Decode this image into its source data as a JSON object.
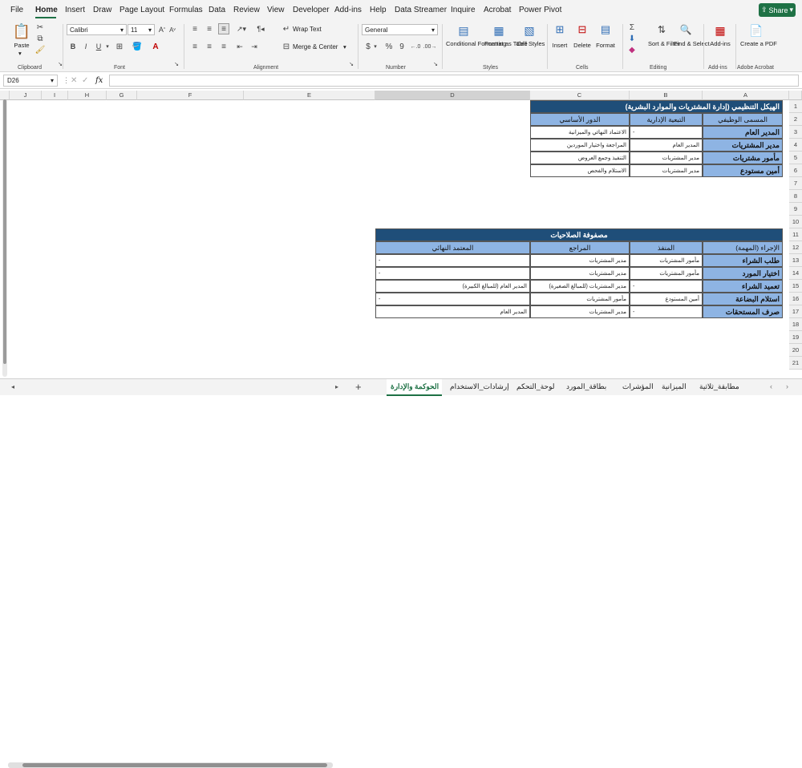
{
  "menu": {
    "tabs": [
      "File",
      "Home",
      "Insert",
      "Draw",
      "Page Layout",
      "Formulas",
      "Data",
      "Review",
      "View",
      "Developer",
      "Add-ins",
      "Help",
      "Data Streamer",
      "Inquire",
      "Acrobat",
      "Power Pivot"
    ],
    "share": "Share"
  },
  "ribbon": {
    "clipboard": {
      "label": "Clipboard",
      "paste": "Paste"
    },
    "font": {
      "label": "Font",
      "name": "Calibri",
      "size": "11",
      "bold": "B",
      "italic": "I",
      "underline": "U"
    },
    "alignment": {
      "label": "Alignment",
      "wrap": "Wrap Text",
      "merge": "Merge & Center"
    },
    "number": {
      "label": "Number",
      "format": "General",
      "currency": "$",
      "percent": "%",
      "comma": "9"
    },
    "styles": {
      "label": "Styles",
      "conditional": "Conditional Formatting",
      "format_table": "Format as Table",
      "cell_styles": "Cell Styles"
    },
    "cells": {
      "label": "Cells",
      "insert": "Insert",
      "delete": "Delete",
      "format": "Format"
    },
    "editing": {
      "label": "Editing",
      "sort": "Sort & Filter",
      "find": "Find & Select",
      "sum": "Σ"
    },
    "addins": {
      "label": "Add-ins",
      "button": "Add-ins"
    },
    "acrobat": {
      "label": "Adobe Acrobat",
      "create": "Create a PDF"
    }
  },
  "formula_bar": {
    "cell_ref": "D26",
    "fx": "fx",
    "value": ""
  },
  "columns": [
    "J",
    "I",
    "H",
    "G",
    "F",
    "E",
    "D",
    "C",
    "B",
    "A"
  ],
  "rows": [
    "1",
    "2",
    "3",
    "4",
    "5",
    "6",
    "7",
    "8",
    "9",
    "10",
    "11",
    "12",
    "13",
    "14",
    "15",
    "16",
    "17",
    "18",
    "19",
    "20",
    "21"
  ],
  "org_table": {
    "title": "الهيكل التنظيمي (إدارة المشتريات والموارد البشرية)",
    "headers": [
      "المسمى الوظيفي",
      "التبعية الإدارية",
      "الدور الأساسي"
    ],
    "rows": [
      [
        "المدير العام",
        "-",
        "الاعتماد النهائي والميزانية"
      ],
      [
        "مدير المشتريات",
        "المدير العام",
        "المراجعة واختيار الموردين"
      ],
      [
        "مأمور مشتريات",
        "مدير المشتريات",
        "التنفيذ وجمع العروض"
      ],
      [
        "أمين مستودع",
        "مدير المشتريات",
        "الاستلام والفحص"
      ]
    ]
  },
  "perm_table": {
    "title": "مصفوفة الصلاحيات",
    "headers": [
      "الإجراء (المهمة)",
      "المنفذ",
      "المراجع",
      "المعتمد النهائي"
    ],
    "rows": [
      [
        "طلب الشراء",
        "مأمور المشتريات",
        "مدير المشتريات",
        "-"
      ],
      [
        "اختيار المورد",
        "مأمور المشتريات",
        "مدير المشتريات",
        "-"
      ],
      [
        "تعميد الشراء",
        "-",
        "مدير المشتريات (للمبالغ الصغيرة)",
        "المدير العام (للمبالغ الكبيرة)"
      ],
      [
        "استلام البضاعة",
        "أمين المستودع",
        "مأمور المشتريات",
        "-"
      ],
      [
        "صرف المستحقات",
        "-",
        "مدير المشتريات",
        "المدير العام"
      ]
    ]
  },
  "sheet_tabs": [
    "الحوكمة والإدارة",
    "إرشادات_الاستخدام",
    "لوحة_التحكم",
    "بطاقة_المورد",
    "المؤشرات",
    "الميزانية",
    "مطابقة_ثلاثية"
  ],
  "active_sheet": "الحوكمة والإدارة"
}
